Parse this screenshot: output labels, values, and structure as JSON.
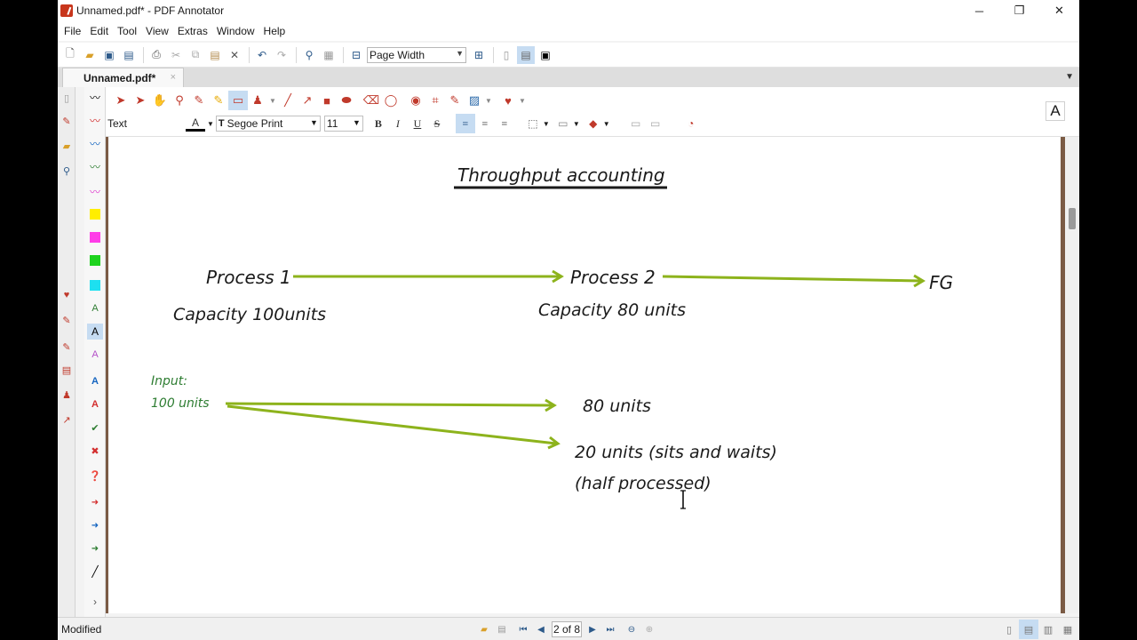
{
  "window": {
    "title": "Unnamed.pdf* - PDF Annotator",
    "minimize": "─",
    "maximize": "❐",
    "close": "✕"
  },
  "menu": [
    "File",
    "Edit",
    "Tool",
    "View",
    "Extras",
    "Window",
    "Help"
  ],
  "toolbar": {
    "zoom_value": "Page Width"
  },
  "tab": {
    "label": "Unnamed.pdf*",
    "close": "×"
  },
  "annotation_toolbar": {
    "tool_name": "Text",
    "font_color_label": "A",
    "font_name": "Segoe Print",
    "font_size": "11",
    "bold": "B",
    "italic": "I",
    "underline": "U",
    "strike": "S",
    "preview_glyph": "A"
  },
  "document": {
    "title": "Throughput accounting",
    "process1": "Process 1",
    "process2": "Process 2",
    "fg": "FG",
    "capacity1": "Capacity 100units",
    "capacity2": "Capacity 80 units",
    "input_label": "Input:",
    "input_value": "100 units",
    "out1": "80 units",
    "out2": "20 units (sits and waits)",
    "out2b": "(half processed)",
    "colors": {
      "ink": "#1a1a1a",
      "arrow": "#8db31c",
      "green_text": "#2e7d32"
    }
  },
  "statusbar": {
    "status": "Modified",
    "page_indicator": "2 of 8"
  }
}
